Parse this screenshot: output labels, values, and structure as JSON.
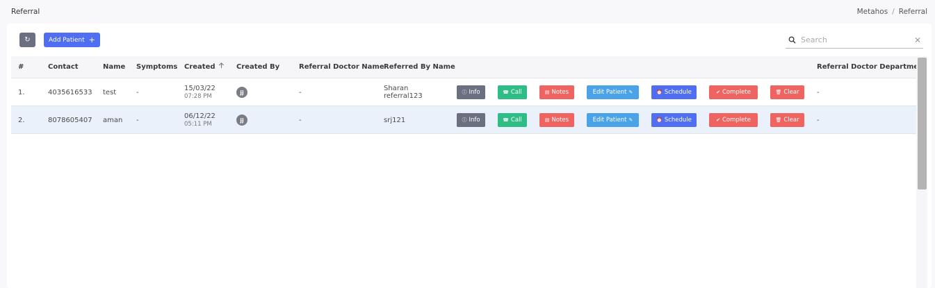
{
  "header": {
    "title": "Referral",
    "breadcrumb": [
      "Metahos",
      "Referral"
    ],
    "separator": "/"
  },
  "toolbar": {
    "refresh_icon": "refresh-icon",
    "add_label": "Add Patient",
    "add_icon": "plus-icon"
  },
  "search": {
    "placeholder": "Search",
    "value": ""
  },
  "table": {
    "columns": {
      "index": "#",
      "contact": "Contact",
      "name": "Name",
      "symptoms": "Symptoms",
      "created": "Created",
      "created_by": "Created By",
      "referral_doctor_name": "Referral Doctor Name",
      "referred_by_name": "Referred By Name",
      "referral_doctor_department": "Referral Doctor Department"
    },
    "rows": [
      {
        "index": "1.",
        "contact": "4035616533",
        "name": "test",
        "symptoms": "-",
        "created_date": "15/03/22",
        "created_time": "07:28 PM",
        "created_by_initials": "jj",
        "referral_doctor_name": "-",
        "referred_by_line1": "Sharan",
        "referred_by_line2": "referral123",
        "department": "-"
      },
      {
        "index": "2.",
        "contact": "8078605407",
        "name": "aman",
        "symptoms": "-",
        "created_date": "06/12/22",
        "created_time": "05:11 PM",
        "created_by_initials": "jj",
        "referral_doctor_name": "-",
        "referred_by_line1": "srj121",
        "referred_by_line2": "",
        "department": "-"
      }
    ]
  },
  "actions": {
    "info": "Info",
    "call": "Call",
    "notes": "Notes",
    "edit": "Edit Patient",
    "schedule": "Schedule",
    "complete": "Complete",
    "clear": "Clear"
  },
  "colors": {
    "info": "#6b7080",
    "call": "#2ebd85",
    "notes": "#ef6461",
    "edit": "#4aa3e8",
    "schedule": "#4f6ef2",
    "complete": "#ef6461",
    "clear": "#ef6461",
    "accent": "#4f6ef2"
  }
}
